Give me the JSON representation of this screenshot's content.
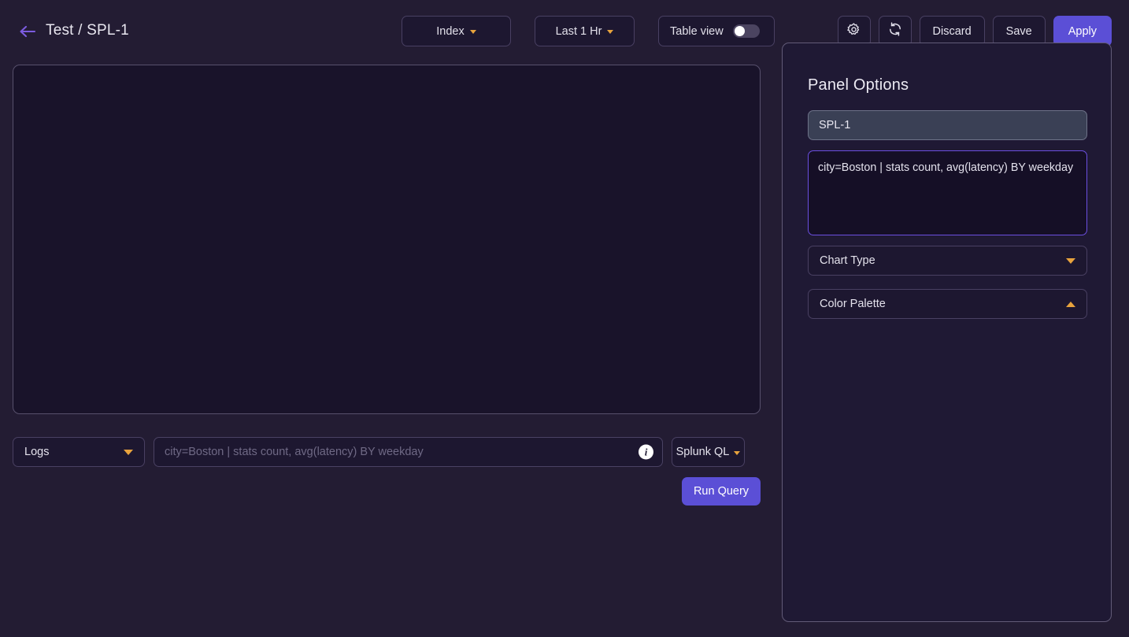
{
  "header": {
    "back_icon": "arrow-left-icon",
    "title": "Test / SPL-1",
    "index_label": "Index",
    "time_range_label": "Last 1 Hr",
    "table_view_label": "Table view",
    "table_view_state": "off",
    "settings_icon": "gear-icon",
    "refresh_icon": "refresh-icon",
    "discard_label": "Discard",
    "save_label": "Save",
    "apply_label": "Apply"
  },
  "query_bar": {
    "source_label": "Logs",
    "query_placeholder": "city=Boston | stats count, avg(latency) BY weekday",
    "query_value": "",
    "info_icon": "info-icon",
    "language_label": "Splunk QL",
    "run_label": "Run Query"
  },
  "panel": {
    "title": "Panel Options",
    "name_value": "SPL-1",
    "name_placeholder": "Panel name",
    "query_value": "city=Boston | stats count, avg(latency) BY weekday",
    "chart_type_label": "Chart Type",
    "chart_type_state": "collapsed",
    "color_palette_label": "Color Palette",
    "color_palette_state": "expanded"
  },
  "colors": {
    "background": "#231c33",
    "panel_bg": "#1f1934",
    "chart_bg": "#19132a",
    "accent_purple": "#5b4fd6",
    "accent_orange": "#e8a33d",
    "focus_border": "#6b4fe0"
  }
}
